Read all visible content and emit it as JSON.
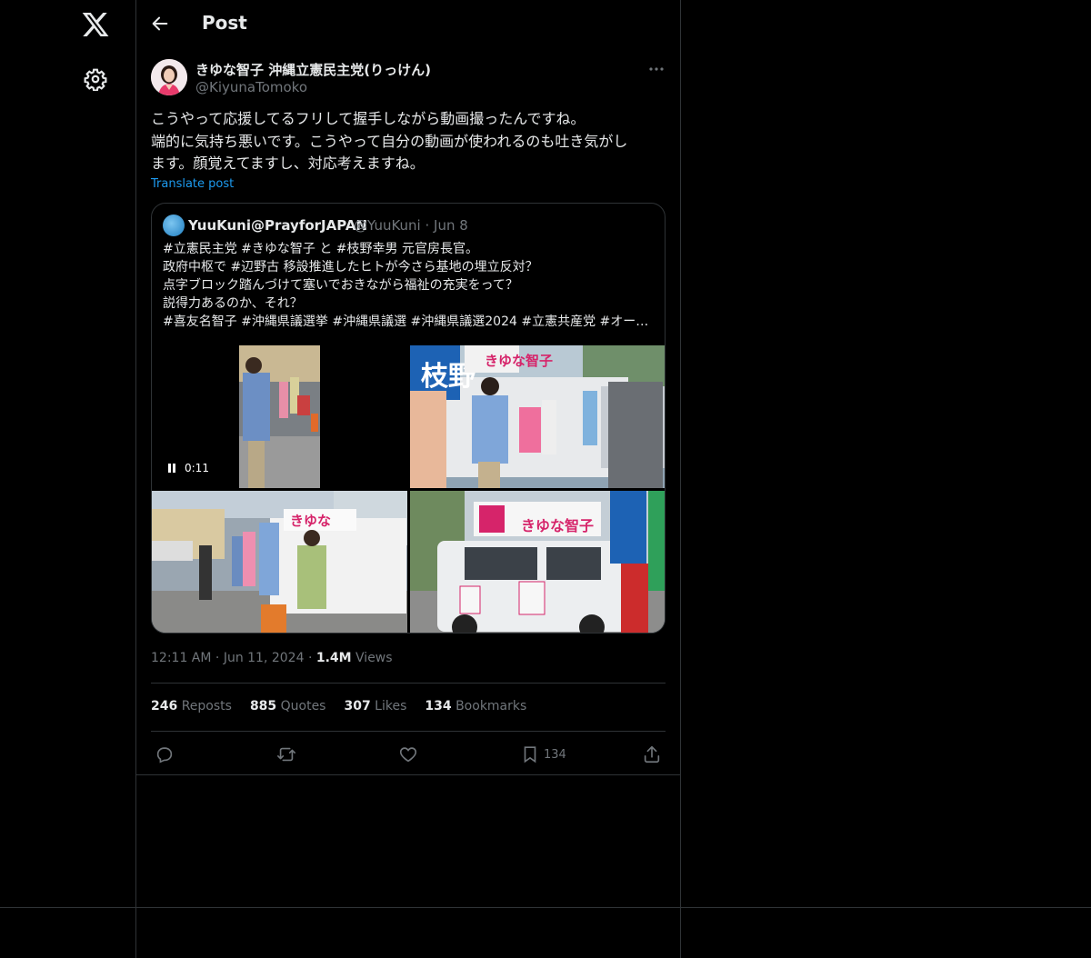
{
  "header": {
    "title": "Post"
  },
  "post": {
    "author_name": "きゆな智子 沖縄立憲民主党(りっけん)",
    "author_handle": "@KiyunaTomoko",
    "text_lines": [
      "こうやって応援してるフリして握手しながら動画撮ったんですね。",
      "端的に気持ち悪いです。こうやって自分の動画が使われるのも吐き気がし",
      "ます。顔覚えてますし、対応考えますね。"
    ],
    "translate_label": "Translate post"
  },
  "quote": {
    "name": "YuuKuni@PrayforJAPAN",
    "handle_date": "@YuuKuni · Jun 8",
    "text_lines": [
      "#立憲民主党 #きゆな智子 と #枝野幸男 元官房長官。",
      "政府中枢で #辺野古 移設推進したヒトが今さら基地の埋立反対？",
      "点字ブロック踏んづけて塞いでおきながら福祉の充実をって？",
      "説得力あるのか、それ？",
      "#喜友名智子 #沖縄県議選挙 #沖縄県議選 #沖縄県議選2024 #立憲共産党 #オー…"
    ],
    "video_time": "0:11",
    "sign_text_1": "枝野",
    "sign_text_2": "きゆな智子",
    "sign_text_3": "きゆな智子",
    "sign_text_4": "きゆな"
  },
  "meta": {
    "time": "12:11 AM",
    "sep1": "·",
    "date": "Jun 11, 2024",
    "sep2": "·",
    "views_count": "1.4M",
    "views_label": "Views"
  },
  "stats": {
    "reposts_count": "246",
    "reposts_label": "Reposts",
    "quotes_count": "885",
    "quotes_label": "Quotes",
    "likes_count": "307",
    "likes_label": "Likes",
    "bookmarks_count": "134",
    "bookmarks_label": "Bookmarks"
  },
  "actions": {
    "bookmark_count": "134"
  },
  "colors": {
    "background": "#000000",
    "link": "#1d9bf0",
    "muted": "#71767b",
    "border": "#2f3336"
  }
}
